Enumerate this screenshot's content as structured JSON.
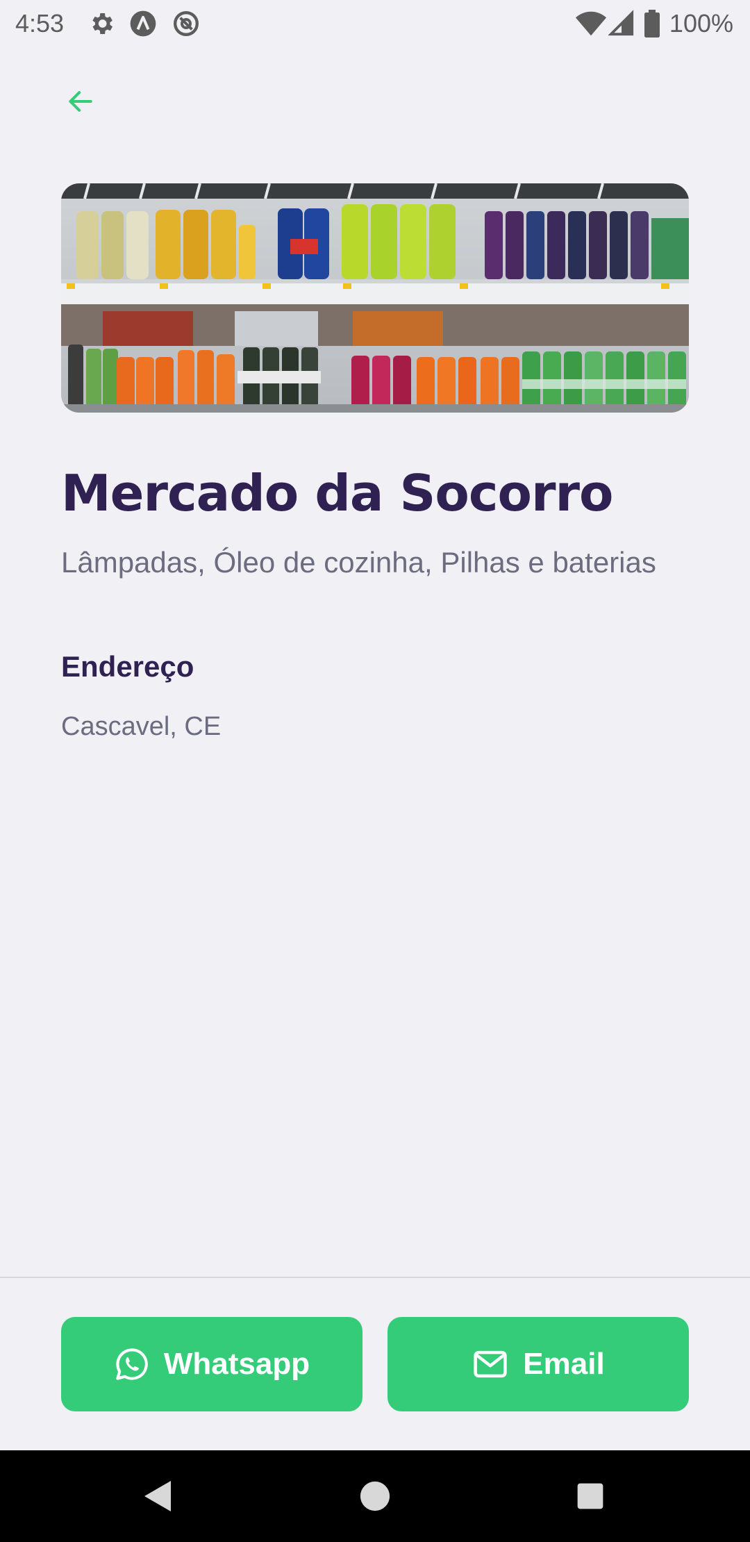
{
  "status_bar": {
    "time": "4:53",
    "battery": "100%",
    "icons": [
      "settings-icon",
      "a-circle-icon",
      "at-sign-icon",
      "wifi-icon",
      "cell-signal-icon",
      "battery-icon"
    ]
  },
  "header": {
    "back_icon": "arrow-left-icon"
  },
  "market": {
    "image_alt": "drinks-shelf-photo",
    "name": "Mercado da Socorro",
    "items": "Lâmpadas, Óleo de cozinha, Pilhas e baterias",
    "address_heading": "Endereço",
    "address": "Cascavel, CE"
  },
  "footer": {
    "whatsapp_label": "Whatsapp",
    "email_label": "Email",
    "whatsapp_icon": "whatsapp-icon",
    "email_icon": "mail-icon"
  },
  "colors": {
    "background": "#f0f0f5",
    "accent": "#34cb79",
    "title": "#2f2151",
    "muted_text": "#6c6c80"
  },
  "nav_bar": {
    "icons": [
      "back-triangle-icon",
      "home-circle-icon",
      "recents-square-icon"
    ]
  }
}
